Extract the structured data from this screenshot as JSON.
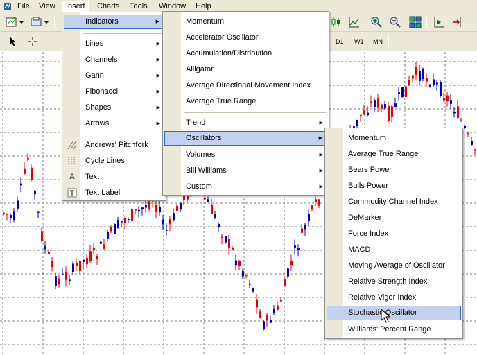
{
  "menubar": {
    "items": [
      "File",
      "View",
      "Insert",
      "Charts",
      "Tools",
      "Window",
      "Help"
    ]
  },
  "timeframes": [
    "D1",
    "W1",
    "MN"
  ],
  "insert_menu": {
    "items": [
      {
        "label": "Indicators",
        "submenu": true,
        "highlighted": true
      },
      {
        "label": "Lines",
        "submenu": true
      },
      {
        "label": "Channels",
        "submenu": true
      },
      {
        "label": "Gann",
        "submenu": true
      },
      {
        "label": "Fibonacci",
        "submenu": true
      },
      {
        "label": "Shapes",
        "submenu": true
      },
      {
        "label": "Arrows",
        "submenu": true
      },
      {
        "label": "Andrews' Pitchfork",
        "icon": "pitchfork-icon"
      },
      {
        "label": "Cycle Lines",
        "icon": "cycle-lines-icon"
      },
      {
        "label": "Text",
        "icon": "text-icon"
      },
      {
        "label": "Text Label",
        "icon": "text-label-icon"
      }
    ]
  },
  "indicators_menu": {
    "items": [
      {
        "label": "Momentum"
      },
      {
        "label": "Accelerator Oscillator"
      },
      {
        "label": "Accumulation/Distribution"
      },
      {
        "label": "Alligator"
      },
      {
        "label": "Average Directional Movement Index"
      },
      {
        "label": "Average True Range"
      },
      {
        "label": "Trend",
        "submenu": true
      },
      {
        "label": "Oscillators",
        "submenu": true,
        "highlighted": true
      },
      {
        "label": "Volumes",
        "submenu": true
      },
      {
        "label": "Bill Williams",
        "submenu": true
      },
      {
        "label": "Custom",
        "submenu": true
      }
    ]
  },
  "oscillators_menu": {
    "items": [
      {
        "label": "Momentum"
      },
      {
        "label": "Average True Range"
      },
      {
        "label": "Bears Power"
      },
      {
        "label": "Bulls Power"
      },
      {
        "label": "Commodity Channel Index"
      },
      {
        "label": "DeMarker"
      },
      {
        "label": "Force Index"
      },
      {
        "label": "MACD"
      },
      {
        "label": "Moving Average of Oscillator"
      },
      {
        "label": "Relative Strength Index"
      },
      {
        "label": "Relative Vigor Index"
      },
      {
        "label": "Stochastic Oscillator",
        "highlighted": true
      },
      {
        "label": "Williams' Percent Range"
      }
    ]
  },
  "colors": {
    "bull_candle": "#0000cc",
    "bear_candle": "#ee0000",
    "grid": "#7f7f7f",
    "menu_highlight": "#c1d2ee",
    "menu_highlight_border": "#316ac5"
  }
}
